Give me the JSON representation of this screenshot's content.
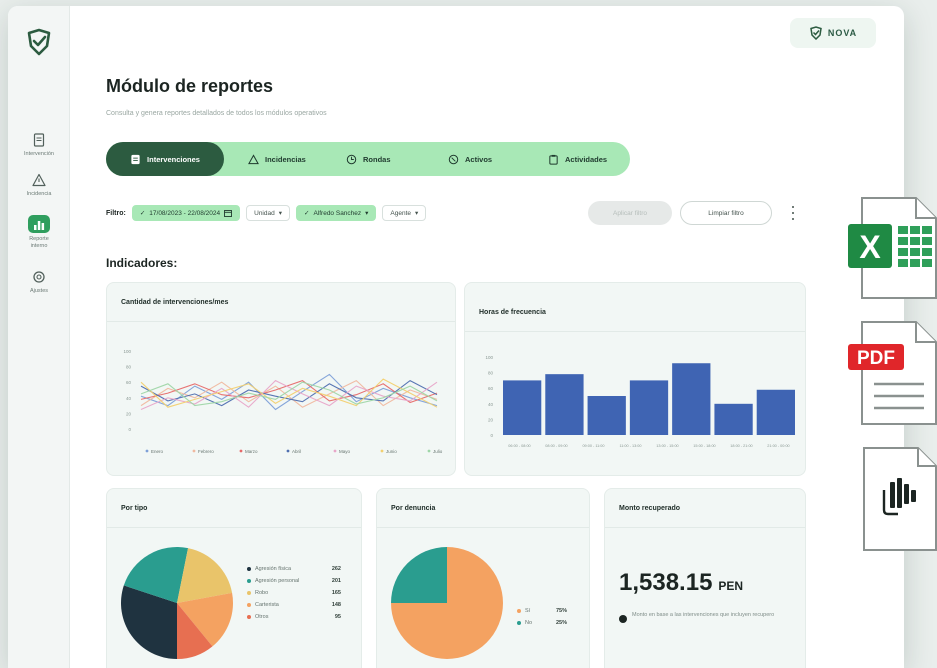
{
  "sidebar": {
    "items": [
      {
        "label": "Intervención",
        "icon": "document-icon"
      },
      {
        "label": "Incidencia",
        "icon": "warning-icon"
      },
      {
        "label": "Reporte interno",
        "icon": "bar-chart-icon",
        "active": true
      },
      {
        "label": "Ajustes",
        "icon": "gear-icon"
      }
    ]
  },
  "brand": {
    "name": "NOVA"
  },
  "header": {
    "title": "Módulo de reportes",
    "subtitle": "Consulta y genera reportes detallados de todos los módulos operativos"
  },
  "tabs": [
    {
      "label": "Intervenciones",
      "active": true,
      "icon": "document-icon"
    },
    {
      "label": "Incidencias",
      "icon": "warning-icon"
    },
    {
      "label": "Rondas",
      "icon": "clock-icon"
    },
    {
      "label": "Activos",
      "icon": "box-icon"
    },
    {
      "label": "Actividades",
      "icon": "clipboard-icon"
    }
  ],
  "filters": {
    "label": "Filtro:",
    "date_range": "17/08/2023 - 22/08/2024",
    "unit": "Unidad",
    "person": "Alfredo Sanchez",
    "agent": "Agente",
    "apply_label": "Aplicar filtro",
    "clear_label": "Limpiar filtro"
  },
  "section_title": "Indicadores:",
  "cards": {
    "line": {
      "title": "Cantidad de intervenciones/mes"
    },
    "bar": {
      "title": "Horas de frecuencia"
    },
    "type": {
      "title": "Por tipo"
    },
    "complaint": {
      "title": "Por denuncia"
    },
    "amount": {
      "title": "Monto recuperado",
      "value": "1,538.15",
      "currency": "PEN",
      "note": "Monto en base a las intervenciones que incluyen recupero"
    }
  },
  "chart_data": [
    {
      "type": "line",
      "title": "Cantidad de intervenciones/mes",
      "x": [
        1,
        2,
        3,
        4,
        5,
        6,
        7,
        8,
        9,
        10,
        11,
        12
      ],
      "ylim": [
        0,
        100
      ],
      "yticks": [
        0,
        20,
        40,
        60,
        80,
        100
      ],
      "series": [
        {
          "name": "Enero",
          "color": "#7ea0d8",
          "values": [
            42,
            30,
            55,
            38,
            60,
            25,
            48,
            70,
            35,
            52,
            40,
            30
          ]
        },
        {
          "name": "Febrero",
          "color": "#f0b9a0",
          "values": [
            30,
            52,
            40,
            60,
            35,
            55,
            28,
            45,
            62,
            30,
            50,
            38
          ]
        },
        {
          "name": "Marzo",
          "color": "#e66a6a",
          "values": [
            38,
            46,
            58,
            44,
            40,
            50,
            62,
            36,
            44,
            58,
            34,
            46
          ]
        },
        {
          "name": "Abril",
          "color": "#4f6fb0",
          "values": [
            55,
            36,
            45,
            30,
            50,
            42,
            35,
            58,
            40,
            36,
            62,
            44
          ]
        },
        {
          "name": "Mayo",
          "color": "#e8a7c9",
          "values": [
            25,
            40,
            32,
            52,
            28,
            62,
            45,
            30,
            55,
            42,
            36,
            60
          ]
        },
        {
          "name": "Junio",
          "color": "#f2d070",
          "values": [
            60,
            28,
            38,
            48,
            58,
            33,
            52,
            42,
            30,
            64,
            46,
            28
          ]
        },
        {
          "name": "Julio",
          "color": "#9fd6a8",
          "values": [
            45,
            58,
            30,
            35,
            46,
            38,
            60,
            50,
            32,
            40,
            55,
            36
          ]
        }
      ]
    },
    {
      "type": "bar",
      "title": "Horas de frecuencia",
      "categories": [
        "06:00 - 08:00",
        "08:00 - 09:00",
        "09:00 - 11:00",
        "11:00 - 13:00",
        "13:00 - 15:00",
        "15:00 - 18:00",
        "18:00 - 21:00",
        "21:00 - 00:00"
      ],
      "values": [
        70,
        78,
        50,
        70,
        92,
        40,
        58
      ],
      "ylim": [
        0,
        100
      ],
      "yticks": [
        0,
        20,
        40,
        60,
        80,
        100
      ],
      "color": "#3f64b3"
    },
    {
      "type": "pie",
      "title": "Por tipo",
      "labels": [
        "Agresión física",
        "Agresión personal",
        "Robo",
        "Carterista",
        "Otros"
      ],
      "values": [
        262,
        201,
        165,
        148,
        95
      ],
      "colors": [
        "#1f3340",
        "#2a9d8f",
        "#e9c46a",
        "#f4a261",
        "#e76f51"
      ]
    },
    {
      "type": "pie",
      "title": "Por denuncia",
      "labels": [
        "Sí",
        "No"
      ],
      "values": [
        75,
        25
      ],
      "value_labels": [
        "75%",
        "25%"
      ],
      "colors": [
        "#f4a261",
        "#2a9d8f"
      ]
    }
  ],
  "export_icons": [
    "excel-file-icon",
    "pdf-file-icon",
    "powerbi-file-icon"
  ]
}
